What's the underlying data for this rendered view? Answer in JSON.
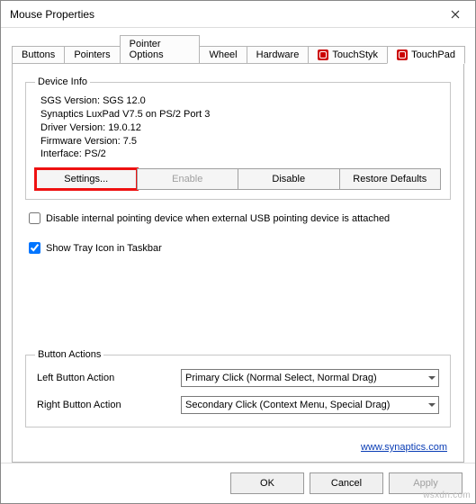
{
  "titlebar": {
    "title": "Mouse Properties"
  },
  "tabs": [
    {
      "label": "Buttons"
    },
    {
      "label": "Pointers"
    },
    {
      "label": "Pointer Options"
    },
    {
      "label": "Wheel"
    },
    {
      "label": "Hardware"
    },
    {
      "label": "TouchStyk",
      "icon": true
    },
    {
      "label": "TouchPad",
      "icon": true,
      "active": true
    }
  ],
  "device_info": {
    "legend": "Device Info",
    "lines": [
      "SGS Version: SGS 12.0",
      "Synaptics LuxPad V7.5 on PS/2 Port 3",
      "Driver Version: 19.0.12",
      "Firmware Version: 7.5",
      "Interface: PS/2"
    ],
    "buttons": {
      "settings": "Settings...",
      "enable": "Enable",
      "disable": "Disable",
      "restore": "Restore Defaults"
    }
  },
  "checkboxes": {
    "disable_internal": {
      "label": "Disable internal pointing device when external USB pointing device is attached",
      "checked": false
    },
    "tray_icon": {
      "label": "Show Tray Icon in Taskbar",
      "checked": true
    }
  },
  "button_actions": {
    "legend": "Button Actions",
    "left_label": "Left Button Action",
    "left_value": "Primary Click (Normal Select, Normal Drag)",
    "right_label": "Right Button Action",
    "right_value": "Secondary Click (Context Menu, Special Drag)"
  },
  "link": {
    "text": "www.synaptics.com"
  },
  "footer": {
    "ok": "OK",
    "cancel": "Cancel",
    "apply": "Apply"
  },
  "watermark": "wsxdn.com"
}
